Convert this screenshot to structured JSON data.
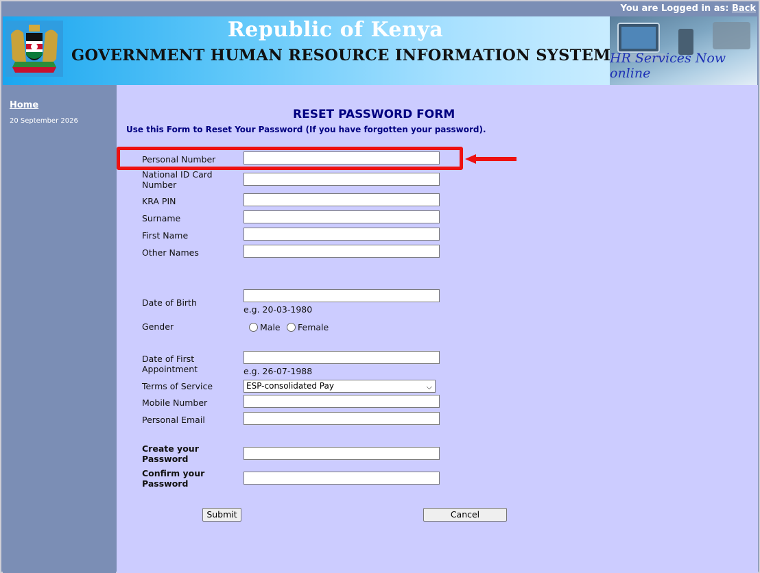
{
  "header": {
    "logged_in_text": "You are Logged in as:",
    "back_link": "Back",
    "title": "Republic of Kenya",
    "subtitle": "GOVERNMENT HUMAN RESOURCE INFORMATION SYSTEM",
    "tagline": "HR Services Now online"
  },
  "sidebar": {
    "home": "Home",
    "date": "20 September 2026"
  },
  "form": {
    "title": "RESET PASSWORD FORM",
    "subtitle": "Use this Form to Reset Your Password (If you have forgotten your password).",
    "labels": {
      "personal_number": "Personal Number",
      "national_id": "National ID Card Number",
      "kra_pin": "KRA PIN",
      "surname": "Surname",
      "first_name": "First Name",
      "other_names": "Other Names",
      "dob": "Date of Birth",
      "gender": "Gender",
      "first_appointment": "Date of First Appointment",
      "terms": "Terms of Service",
      "mobile": "Mobile Number",
      "email": "Personal Email",
      "create_password": "Create your Password",
      "confirm_password": "Confirm your Password"
    },
    "values": {
      "personal_number": "",
      "national_id": "",
      "kra_pin": "",
      "surname": "",
      "first_name": "",
      "other_names": "",
      "dob": "",
      "first_appointment": "",
      "mobile": "",
      "email": "",
      "create_password": "",
      "confirm_password": ""
    },
    "dob_hint": "e.g. 20-03-1980",
    "appointment_hint": "e.g. 26-07-1988",
    "gender_options": [
      "Male",
      "Female"
    ],
    "terms_selected": "ESP-consolidated Pay",
    "submit": "Submit",
    "cancel": "Cancel"
  },
  "colors": {
    "main_bg": "#ccccff",
    "sidebar_bg": "#7b8eb5",
    "title_color": "#000080",
    "highlight": "#ee1111"
  }
}
